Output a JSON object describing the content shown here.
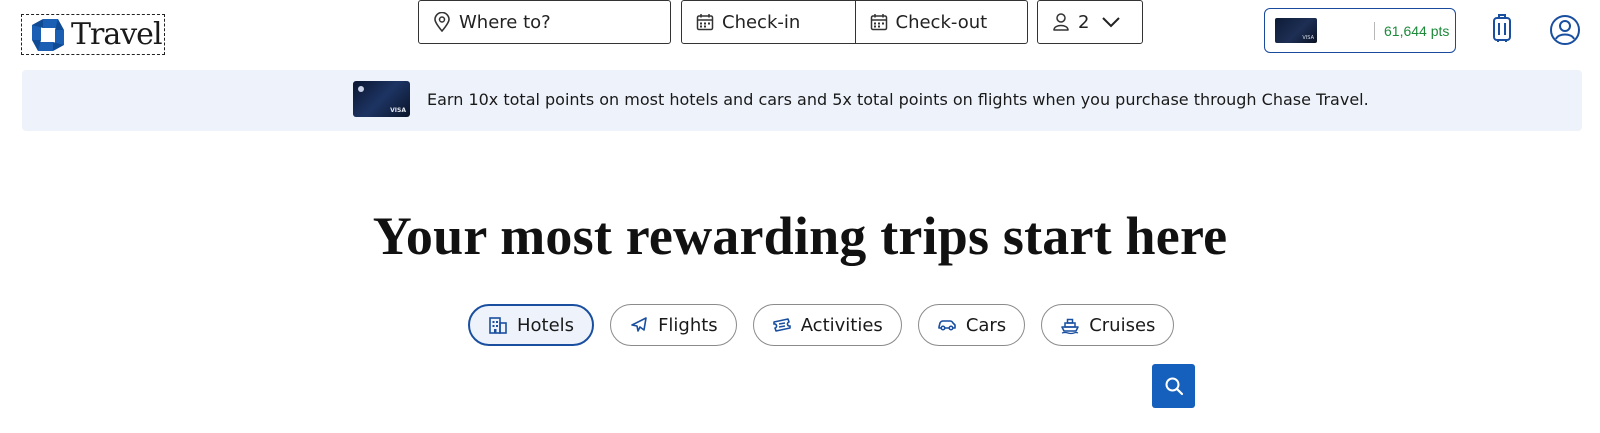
{
  "header": {
    "logo_text": "Travel",
    "points": "61,644 pts",
    "colors": {
      "brand_blue": "#1a4fa0",
      "points_green": "#1d8a3a"
    }
  },
  "banner": {
    "text": "Earn 10x total points on most hotels and cars and 5x total points on flights when you purchase through Chase Travel."
  },
  "hero": {
    "title": "Your most rewarding trips start here"
  },
  "tabs": [
    {
      "label": "Hotels",
      "icon": "building-icon",
      "active": true
    },
    {
      "label": "Flights",
      "icon": "plane-icon",
      "active": false
    },
    {
      "label": "Activities",
      "icon": "ticket-icon",
      "active": false
    },
    {
      "label": "Cars",
      "icon": "car-icon",
      "active": false
    },
    {
      "label": "Cruises",
      "icon": "ship-icon",
      "active": false
    }
  ],
  "search": {
    "destination_placeholder": "Where to?",
    "checkin_placeholder": "Check-in",
    "checkout_placeholder": "Check-out",
    "guests": "2",
    "search_button_color": "#1560bd"
  }
}
